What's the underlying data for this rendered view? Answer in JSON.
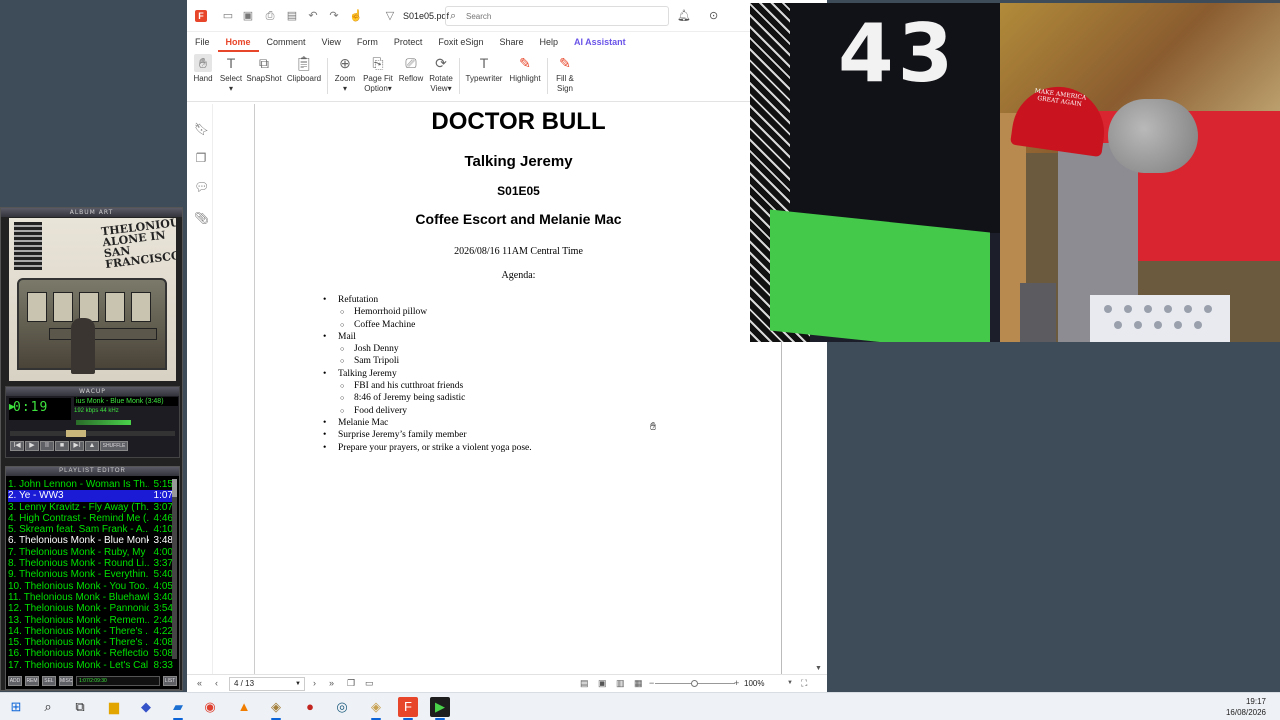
{
  "player": {
    "album_art_label": "ALBUM ART",
    "album_title": "THELONIOUS ALONE IN SAN FRANCISCO",
    "main_label": "WACUP",
    "time": "0:19",
    "scroll_text": "ius Monk - Blue Monk (3:48)",
    "kbps": "192 kbps   44 kHz",
    "controls": [
      "I◀",
      "▶",
      "II",
      "■",
      "▶I",
      "▲"
    ],
    "shuffle_label": "SHUFFLE",
    "playlist_title": "PLAYLIST EDITOR",
    "playlist": [
      {
        "title": "1. John Lennon - Woman Is Th...",
        "dur": "5:15"
      },
      {
        "title": "2. Ye - WW3",
        "dur": "1:07"
      },
      {
        "title": "3. Lenny Kravitz - Fly Away (Th...",
        "dur": "3:07"
      },
      {
        "title": "4. High Contrast - Remind Me (...",
        "dur": "4:46"
      },
      {
        "title": "5. Skream feat. Sam Frank - A...",
        "dur": "4:10"
      },
      {
        "title": "6. Thelonious Monk - Blue Monk",
        "dur": "3:48"
      },
      {
        "title": "7. Thelonious Monk - Ruby, My ...",
        "dur": "4:00"
      },
      {
        "title": "8. Thelonious Monk - Round Li...",
        "dur": "3:37"
      },
      {
        "title": "9. Thelonious Monk - Everythin...",
        "dur": "5:40"
      },
      {
        "title": "10. Thelonious Monk - You Too...",
        "dur": "4:05"
      },
      {
        "title": "11. Thelonious Monk - Bluehawk",
        "dur": "3:40"
      },
      {
        "title": "12. Thelonious Monk - Pannonica",
        "dur": "3:54"
      },
      {
        "title": "13. Thelonious Monk - Remem...",
        "dur": "2:44"
      },
      {
        "title": "14. Thelonious Monk - There's ...",
        "dur": "4:22"
      },
      {
        "title": "15. Thelonious Monk - There's ...",
        "dur": "4:08"
      },
      {
        "title": "16. Thelonious Monk - Reflectio...",
        "dur": "5:08"
      },
      {
        "title": "17. Thelonious Monk - Let's Cal...",
        "dur": "8:33"
      }
    ],
    "playlist_buttons": [
      "ADD",
      "REM",
      "SEL",
      "MISC",
      "LIST"
    ],
    "mini_status": "1:07/2:09:30"
  },
  "pdf": {
    "file_name": "S01e05.pdf",
    "search_placeholder": "Search",
    "menu": [
      "File",
      "Home",
      "Comment",
      "View",
      "Form",
      "Protect",
      "Foxit eSign",
      "Share",
      "Help",
      "AI Assistant"
    ],
    "active_menu": "Home",
    "ribbon": {
      "hand": "Hand",
      "select": "Select",
      "snapshot": "SnapShot",
      "clipboard": "Clipboard",
      "zoom": "Zoom",
      "page_fit_1": "Page Fit",
      "page_fit_2": "Option",
      "reflow": "Reflow",
      "rotate_1": "Rotate",
      "rotate_2": "View",
      "typewriter": "Typewriter",
      "highlight": "Highlight",
      "fill_1": "Fill &",
      "fill_2": "Sign"
    },
    "document": {
      "title": "DOCTOR BULL",
      "subtitle": "Talking Jeremy",
      "episode": "S01E05",
      "segment": "Coffee Escort and Melanie Mac",
      "datetime": "2026/08/16 11AM Central Time",
      "agenda_label": "Agenda:",
      "agenda": [
        {
          "level": 1,
          "text": "Refutation"
        },
        {
          "level": 2,
          "text": "Hemorrhoid pillow"
        },
        {
          "level": 2,
          "text": "Coffee Machine"
        },
        {
          "level": 1,
          "text": "Mail"
        },
        {
          "level": 2,
          "text": "Josh Denny"
        },
        {
          "level": 2,
          "text": "Sam Tripoli"
        },
        {
          "level": 1,
          "text": "Talking Jeremy"
        },
        {
          "level": 2,
          "text": "FBI and his cutthroat friends"
        },
        {
          "level": 2,
          "text": "8:46 of Jeremy being sadistic"
        },
        {
          "level": 2,
          "text": "Food delivery"
        },
        {
          "level": 1,
          "text": "Melanie Mac"
        },
        {
          "level": 1,
          "text": "Surprise Jeremy’s family member"
        },
        {
          "level": 1,
          "text": "Prepare your prayers, or strike a violent yoga pose."
        }
      ]
    },
    "status": {
      "page_indicator": "4 / 13",
      "zoom": "100%"
    }
  },
  "webcam": {
    "jersey_number": "43",
    "hat_text": "MAKE AMERICA GREAT AGAIN"
  },
  "taskbar": {
    "time": "19:17",
    "date": "16/08/2026"
  }
}
